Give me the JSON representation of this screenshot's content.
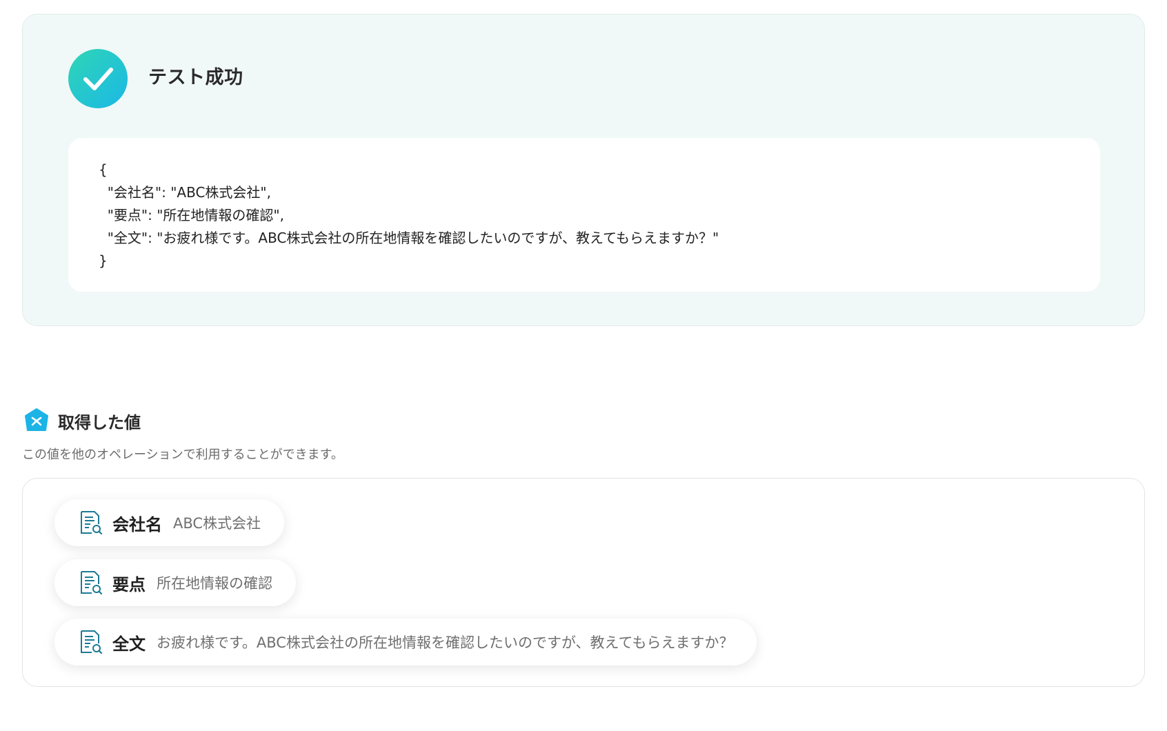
{
  "success": {
    "title": "テスト成功",
    "json_lines": [
      "{",
      "  \"会社名\": \"ABC株式会社\",",
      "  \"要点\": \"所在地情報の確認\",",
      "  \"全文\": \"お疲れ様です。ABC株式会社の所在地情報を確認したいのですが、教えてもらえますか？\"",
      "}"
    ],
    "icon": "check-icon",
    "accent_start": "#2fd6b5",
    "accent_end": "#1bb8e6"
  },
  "values": {
    "title": "取得した値",
    "description": "この値を他のオペレーションで利用することができます。",
    "icon": "variable-badge-icon",
    "items": [
      {
        "key": "会社名",
        "value": "ABC株式会社",
        "icon": "document-search-icon"
      },
      {
        "key": "要点",
        "value": "所在地情報の確認",
        "icon": "document-search-icon"
      },
      {
        "key": "全文",
        "value": "お疲れ様です。ABC株式会社の所在地情報を確認したいのですが、教えてもらえますか？",
        "icon": "document-search-icon"
      }
    ]
  }
}
